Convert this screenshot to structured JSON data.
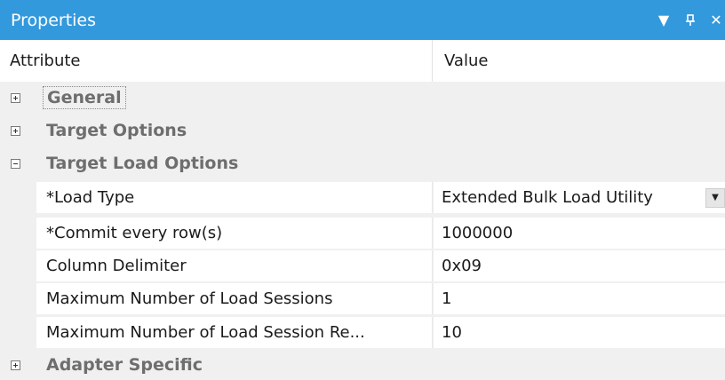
{
  "window": {
    "title": "Properties",
    "dropdown_icon": "▼",
    "pin_icon": "ꟸ",
    "close_icon": "✕"
  },
  "columns": {
    "attribute": "Attribute",
    "value": "Value"
  },
  "categories": [
    {
      "label": "General",
      "expanded": false
    },
    {
      "label": "Target Options",
      "expanded": false
    },
    {
      "label": "Target Load Options",
      "expanded": true
    },
    {
      "label": "Adapter Specific",
      "expanded": false
    }
  ],
  "properties": [
    {
      "name": "*Load Type",
      "value": "Extended Bulk Load Utility"
    },
    {
      "name": "*Commit every row(s)",
      "value": "1000000"
    },
    {
      "name": "Column Delimiter",
      "value": "0x09"
    },
    {
      "name": "Maximum Number of Load Sessions",
      "value": "1"
    },
    {
      "name": "Maximum Number of Load Session Re...",
      "value": "10"
    }
  ],
  "colors": {
    "titlebar": "#3399dd",
    "background": "#f0f0f0",
    "category_text": "#6e6e6e"
  }
}
